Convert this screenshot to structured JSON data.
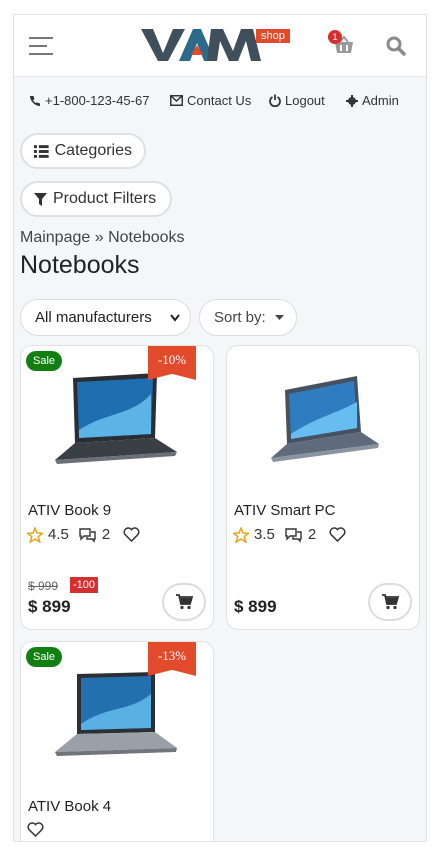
{
  "header": {
    "logo_text": "VAM",
    "logo_tag": "shop",
    "cart_count": "1"
  },
  "infobar": {
    "phone": "+1-800-123-45-67",
    "contact": "Contact Us",
    "logout": "Logout",
    "admin": "Admin"
  },
  "buttons": {
    "categories": "Categories",
    "filters": "Product Filters"
  },
  "breadcrumb": "Mainpage » Notebooks",
  "page_title": "Notebooks",
  "filters": {
    "manufacturer": "All manufacturers",
    "sort": "Sort by:"
  },
  "products": [
    {
      "name": "ATIV Book 9",
      "sale": "Sale",
      "discount": "-10%",
      "rating": "4.5",
      "comments": "2",
      "old_price": "$ 999",
      "save": "-100",
      "price": "$ 899"
    },
    {
      "name": "ATIV Smart PC",
      "rating": "3.5",
      "comments": "2",
      "price": "$ 899"
    },
    {
      "name": "ATIV Book 4",
      "sale": "Sale",
      "discount": "-13%"
    }
  ],
  "colors": {
    "accent": "#e24a2c",
    "sale": "#137f13",
    "badge": "#d62f2f"
  }
}
